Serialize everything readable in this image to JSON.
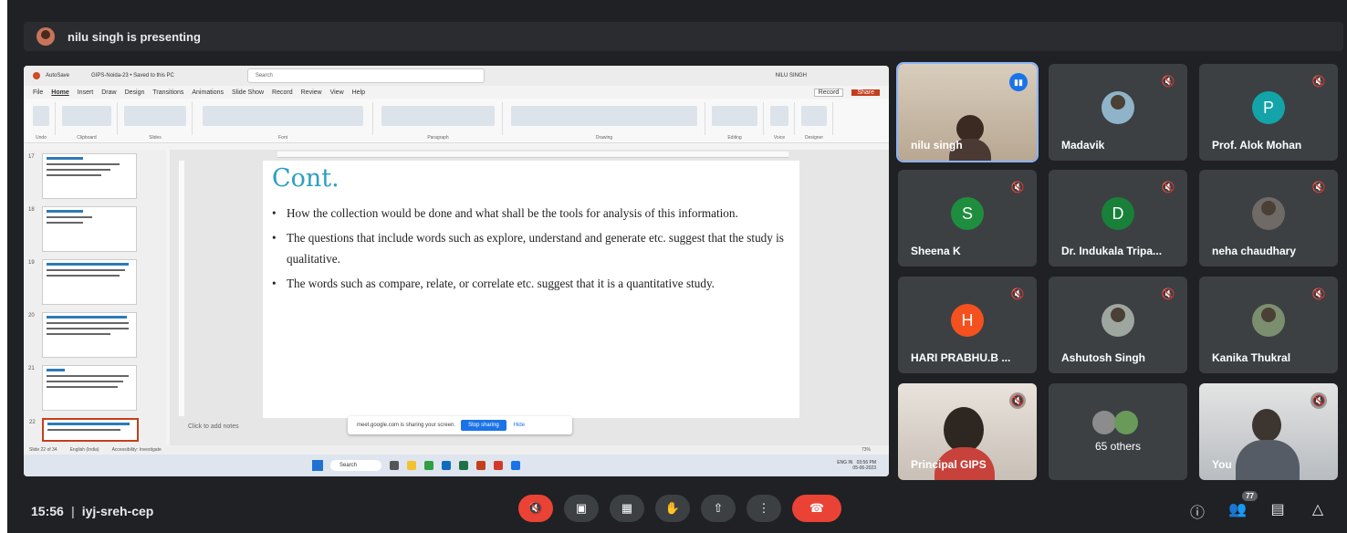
{
  "presenting_banner": "nilu singh is presenting",
  "ppt": {
    "autosave": "AutoSave",
    "file_title": "GIPS-Noida-23 • Saved to this PC",
    "search_placeholder": "Search",
    "user": "NILU SINGH",
    "menu": [
      "File",
      "Home",
      "Insert",
      "Draw",
      "Design",
      "Transitions",
      "Animations",
      "Slide Show",
      "Record",
      "Review",
      "View",
      "Help"
    ],
    "record_btn": "Record",
    "share_btn": "Share",
    "ribbon_groups": [
      "Undo",
      "Clipboard",
      "Slides",
      "Font",
      "Paragraph",
      "Drawing",
      "Editing",
      "Voice",
      "Designer"
    ],
    "thumb_numbers": [
      "17",
      "18",
      "19",
      "20",
      "21",
      "22"
    ],
    "slide_title": "Cont.",
    "bullets": [
      "How the collection would be done and what shall be the tools for analysis of this information.",
      "The questions that include words such as explore, understand and generate etc. suggest that the study is qualitative.",
      "The words such as compare, relate, or correlate etc. suggest that it is a quantitative study."
    ],
    "notes_placeholder": "Click to add notes",
    "sharing_msg": "meet.google.com is sharing your screen.",
    "stop_sharing": "Stop sharing",
    "hide": "Hide",
    "status_slide": "Slide 22 of 34",
    "status_lang": "English (India)",
    "status_access": "Accessibility: Investigate",
    "zoom": "73%",
    "taskbar_search": "Search",
    "tray_lang": "ENG IN",
    "tray_time": "03:56 PM",
    "tray_date": "05-06-2023"
  },
  "tiles": [
    {
      "name": "nilu singh",
      "initial": "",
      "color": ""
    },
    {
      "name": "Madavik",
      "initial": "",
      "color": ""
    },
    {
      "name": "Prof. Alok Mohan",
      "initial": "P",
      "color": "#12a4a8"
    },
    {
      "name": "Sheena K",
      "initial": "S",
      "color": "#1e8e3e"
    },
    {
      "name": "Dr. Indukala Tripa...",
      "initial": "D",
      "color": "#188038"
    },
    {
      "name": "neha chaudhary",
      "initial": "",
      "color": ""
    },
    {
      "name": "HARI PRABHU.B ...",
      "initial": "H",
      "color": "#f4511e"
    },
    {
      "name": "Ashutosh Singh",
      "initial": "",
      "color": ""
    },
    {
      "name": "Kanika Thukral",
      "initial": "",
      "color": ""
    },
    {
      "name": "Principal GIPS",
      "initial": "",
      "color": ""
    },
    {
      "name": "65 others",
      "initial": "",
      "color": ""
    },
    {
      "name": "You",
      "initial": "",
      "color": ""
    }
  ],
  "bottom": {
    "time": "15:56",
    "meeting_code": "iyj-sreh-cep",
    "participants_count": "77"
  }
}
